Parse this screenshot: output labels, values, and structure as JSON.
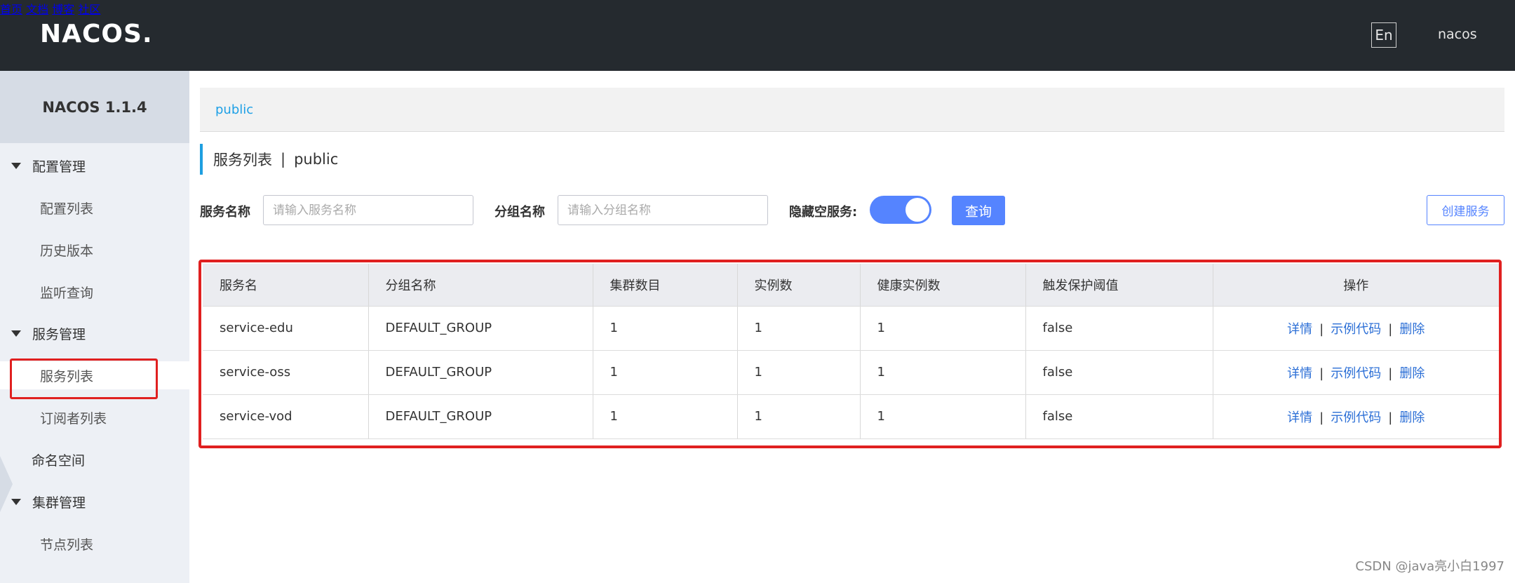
{
  "header": {
    "logo_text": "NACOS.",
    "nav": [
      {
        "label": "首页"
      },
      {
        "label": "文档"
      },
      {
        "label": "博客"
      },
      {
        "label": "社区"
      }
    ],
    "lang_button": "En",
    "user": "nacos"
  },
  "sidebar": {
    "version": "NACOS 1.1.4",
    "groups": [
      {
        "label": "配置管理",
        "items": [
          {
            "label": "配置列表"
          },
          {
            "label": "历史版本"
          },
          {
            "label": "监听查询"
          }
        ]
      },
      {
        "label": "服务管理",
        "items": [
          {
            "label": "服务列表",
            "active": true
          },
          {
            "label": "订阅者列表"
          }
        ]
      },
      {
        "label": "命名空间"
      },
      {
        "label": "集群管理",
        "items": [
          {
            "label": "节点列表"
          }
        ]
      }
    ]
  },
  "breadcrumb": {
    "namespace": "public"
  },
  "page": {
    "title": "服务列表",
    "separator": "|",
    "namespace": "public"
  },
  "filters": {
    "service_name_label": "服务名称",
    "service_name_placeholder": "请输入服务名称",
    "group_name_label": "分组名称",
    "group_name_placeholder": "请输入分组名称",
    "hide_empty_label": "隐藏空服务:",
    "hide_empty_on": true,
    "query_button": "查询",
    "create_button": "创建服务"
  },
  "table": {
    "columns": [
      "服务名",
      "分组名称",
      "集群数目",
      "实例数",
      "健康实例数",
      "触发保护阈值",
      "操作"
    ],
    "rows": [
      {
        "name": "service-edu",
        "group": "DEFAULT_GROUP",
        "clusters": "1",
        "instances": "1",
        "healthy": "1",
        "threshold": "false"
      },
      {
        "name": "service-oss",
        "group": "DEFAULT_GROUP",
        "clusters": "1",
        "instances": "1",
        "healthy": "1",
        "threshold": "false"
      },
      {
        "name": "service-vod",
        "group": "DEFAULT_GROUP",
        "clusters": "1",
        "instances": "1",
        "healthy": "1",
        "threshold": "false"
      }
    ],
    "actions": {
      "detail": "详情",
      "sample": "示例代码",
      "delete": "删除",
      "pipe": "|"
    }
  },
  "watermark": "CSDN @java亮小白1997",
  "colors": {
    "header_bg": "#252a2f",
    "accent": "#5584ff",
    "link": "#2c6fd6",
    "highlight": "#e02020"
  }
}
